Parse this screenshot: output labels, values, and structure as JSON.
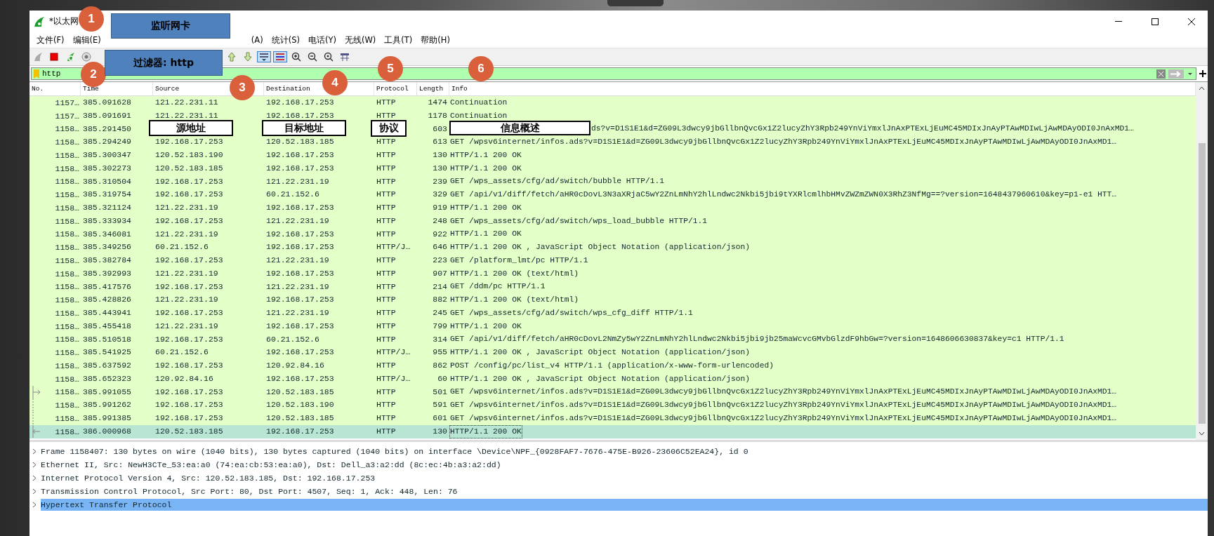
{
  "window": {
    "title": "*以太网"
  },
  "menu": [
    "文件(F)",
    "编辑(E)",
    "(A)",
    "统计(S)",
    "电话(Y)",
    "无线(W)",
    "工具(T)",
    "帮助(H)"
  ],
  "toolbar": [
    {
      "kind": "fin",
      "on": false
    },
    {
      "kind": "stop",
      "on": false
    },
    {
      "kind": "restart",
      "on": false
    },
    {
      "kind": "options",
      "on": false
    },
    {
      "kind": "first",
      "on": false
    },
    {
      "kind": "last",
      "on": false
    },
    {
      "kind": "autoscroll",
      "on": true
    },
    {
      "kind": "colorize",
      "on": true
    },
    {
      "kind": "zoom-in",
      "on": false
    },
    {
      "kind": "zoom-out",
      "on": false
    },
    {
      "kind": "zoom-reset",
      "on": false
    },
    {
      "kind": "resize",
      "on": false
    }
  ],
  "filter": {
    "value": "http"
  },
  "table": {
    "columns": [
      "No.",
      "Time",
      "Source",
      "Destination",
      "Protocol",
      "Length",
      "Info"
    ],
    "rows": [
      {
        "no": "1157…",
        "time": "385.091628",
        "source": "121.22.231.11",
        "destination": "192.168.17.253",
        "protocol": "HTTP",
        "length": "1474",
        "info": "Continuation",
        "selected": false
      },
      {
        "no": "1157…",
        "time": "385.091691",
        "source": "121.22.231.11",
        "destination": "192.168.17.253",
        "protocol": "HTTP",
        "length": "1178",
        "info": "Continuation",
        "selected": false
      },
      {
        "no": "1158…",
        "time": "385.291450",
        "length": "603",
        "info": "ds?v=D1S1E1&d=ZG09L3dwcy9jbGllbnQvcGx1Z2lucyZhY3Rpb249YnViYmxlJnAxPTExLjEuMC45MDIxJnAyPTAwMDIwLjAwMDAyODI0JnAxMD1…",
        "covered": true,
        "selected": false
      },
      {
        "no": "1158…",
        "time": "385.294249",
        "source": "192.168.17.253",
        "destination": "120.52.183.185",
        "protocol": "HTTP",
        "length": "613",
        "info": "GET /wpsv6internet/infos.ads?v=D1S1E1&d=ZG09L3dwcy9jbGllbnQvcGx1Z2lucyZhY3Rpb249YnViYmxlJnAxPTExLjEuMC45MDIxJnAyPTAwMDIwLjAwMDAyODI0JnAxMD1…",
        "selected": false
      },
      {
        "no": "1158…",
        "time": "385.300347",
        "source": "120.52.183.190",
        "destination": "192.168.17.253",
        "protocol": "HTTP",
        "length": "130",
        "info": "HTTP/1.1 200 OK",
        "selected": false
      },
      {
        "no": "1158…",
        "time": "385.302273",
        "source": "120.52.183.185",
        "destination": "192.168.17.253",
        "protocol": "HTTP",
        "length": "130",
        "info": "HTTP/1.1 200 OK",
        "selected": false
      },
      {
        "no": "1158…",
        "time": "385.310504",
        "source": "192.168.17.253",
        "destination": "121.22.231.19",
        "protocol": "HTTP",
        "length": "239",
        "info": "GET /wps_assets/cfg/ad/switch/bubble HTTP/1.1",
        "selected": false
      },
      {
        "no": "1158…",
        "time": "385.319754",
        "source": "192.168.17.253",
        "destination": "60.21.152.6",
        "protocol": "HTTP",
        "length": "329",
        "info": "GET /api/v1/diff/fetch/aHR0cDovL3N3aXRjaC5wY2ZnLmNhY2hlLndwc2Nkbi5jbi9tYXRlcmlhbHMvZWZmZWN0X3RhZ3NfMg==?version=1648437960610&key=p1-e1 HTT…",
        "selected": false
      },
      {
        "no": "1158…",
        "time": "385.321124",
        "source": "121.22.231.19",
        "destination": "192.168.17.253",
        "protocol": "HTTP",
        "length": "919",
        "info": "HTTP/1.1 200 OK",
        "selected": false
      },
      {
        "no": "1158…",
        "time": "385.333934",
        "source": "192.168.17.253",
        "destination": "121.22.231.19",
        "protocol": "HTTP",
        "length": "248",
        "info": "GET /wps_assets/cfg/ad/switch/wps_load_bubble HTTP/1.1",
        "selected": false
      },
      {
        "no": "1158…",
        "time": "385.346081",
        "source": "121.22.231.19",
        "destination": "192.168.17.253",
        "protocol": "HTTP",
        "length": "922",
        "info": "HTTP/1.1 200 OK",
        "selected": false
      },
      {
        "no": "1158…",
        "time": "385.349256",
        "source": "60.21.152.6",
        "destination": "192.168.17.253",
        "protocol": "HTTP/J…",
        "length": "646",
        "info": "HTTP/1.1 200 OK , JavaScript Object Notation (application/json)",
        "selected": false
      },
      {
        "no": "1158…",
        "time": "385.382784",
        "source": "192.168.17.253",
        "destination": "121.22.231.19",
        "protocol": "HTTP",
        "length": "223",
        "info": "GET /platform_lmt/pc HTTP/1.1",
        "selected": false
      },
      {
        "no": "1158…",
        "time": "385.392993",
        "source": "121.22.231.19",
        "destination": "192.168.17.253",
        "protocol": "HTTP",
        "length": "907",
        "info": "HTTP/1.1 200 OK  (text/html)",
        "selected": false
      },
      {
        "no": "1158…",
        "time": "385.417576",
        "source": "192.168.17.253",
        "destination": "121.22.231.19",
        "protocol": "HTTP",
        "length": "214",
        "info": "GET /ddm/pc HTTP/1.1",
        "selected": false
      },
      {
        "no": "1158…",
        "time": "385.428826",
        "source": "121.22.231.19",
        "destination": "192.168.17.253",
        "protocol": "HTTP",
        "length": "882",
        "info": "HTTP/1.1 200 OK  (text/html)",
        "selected": false
      },
      {
        "no": "1158…",
        "time": "385.443941",
        "source": "192.168.17.253",
        "destination": "121.22.231.19",
        "protocol": "HTTP",
        "length": "245",
        "info": "GET /wps_assets/cfg/ad/switch/wps_cfg_diff HTTP/1.1",
        "selected": false
      },
      {
        "no": "1158…",
        "time": "385.455418",
        "source": "121.22.231.19",
        "destination": "192.168.17.253",
        "protocol": "HTTP",
        "length": "799",
        "info": "HTTP/1.1 200 OK",
        "selected": false
      },
      {
        "no": "1158…",
        "time": "385.510518",
        "source": "192.168.17.253",
        "destination": "60.21.152.6",
        "protocol": "HTTP",
        "length": "314",
        "info": "GET /api/v1/diff/fetch/aHR0cDovL2NmZy5wY2ZnLmNhY2hlLndwc2Nkbi5jbi9jb25maWcvcGMvbGlzdF9hbGw=?version=1648606630837&key=c1 HTTP/1.1",
        "selected": false
      },
      {
        "no": "1158…",
        "time": "385.541925",
        "source": "60.21.152.6",
        "destination": "192.168.17.253",
        "protocol": "HTTP/J…",
        "length": "955",
        "info": "HTTP/1.1 200 OK , JavaScript Object Notation (application/json)",
        "selected": false
      },
      {
        "no": "1158…",
        "time": "385.637592",
        "source": "192.168.17.253",
        "destination": "120.92.84.16",
        "protocol": "HTTP",
        "length": "862",
        "info": "POST /config/pc/list_v4 HTTP/1.1  (application/x-www-form-urlencoded)",
        "selected": false
      },
      {
        "no": "1158…",
        "time": "385.652323",
        "source": "120.92.84.16",
        "destination": "192.168.17.253",
        "protocol": "HTTP/J…",
        "length": "60",
        "info": "HTTP/1.1 200 OK , JavaScript Object Notation (application/json)",
        "selected": false
      },
      {
        "no": "1158…",
        "time": "385.991055",
        "source": "192.168.17.253",
        "destination": "120.52.183.185",
        "protocol": "HTTP",
        "length": "501",
        "info": "GET /wpsv6internet/infos.ads?v=D1S1E1&d=ZG09L3dwcy9jbGllbnQvcGx1Z2lucyZhY3Rpb249YnViYmxlJnAxPTExLjEuMC45MDIxJnAyPTAwMDIwLjAwMDAyODI0JnAxMD1…",
        "request_arrow": true,
        "selected": false
      },
      {
        "no": "1158…",
        "time": "385.991262",
        "source": "192.168.17.253",
        "destination": "120.52.183.190",
        "protocol": "HTTP",
        "length": "591",
        "info": "GET /wpsv6internet/infos.ads?v=D1S1E1&d=ZG09L3dwcy9jbGllbnQvcGx1Z2lucyZhY3Rpb249YnViYmxlJnAxPTExLjEuMC45MDIxJnAyPTAwMDIwLjAwMDAyODI0JnAxMD1…",
        "related_line": true,
        "selected": false
      },
      {
        "no": "1158…",
        "time": "385.991385",
        "source": "192.168.17.253",
        "destination": "120.52.183.185",
        "protocol": "HTTP",
        "length": "601",
        "info": "GET /wpsv6internet/infos.ads?v=D1S1E1&d=ZG09L3dwcy9jbGllbnQvcGx1Z2lucyZhY3Rpb249YnViYmxlJnAxPTExLjEuMC45MDIxJnAyPTAwMDIwLjAwMDAyODI0JnAxMD1…",
        "related_line": true,
        "selected": false
      },
      {
        "no": "1158…",
        "time": "386.000968",
        "source": "120.52.183.185",
        "destination": "192.168.17.253",
        "protocol": "HTTP",
        "length": "130",
        "info": "HTTP/1.1 200 OK",
        "response_arrow": true,
        "selected": true
      }
    ]
  },
  "details": [
    {
      "text": "Frame 1158407: 130 bytes on wire (1040 bits), 130 bytes captured (1040 bits) on interface \\Device\\NPF_{0928FAF7-7676-475E-B926-23606C52EA24}, id 0",
      "expanded": false,
      "selected": false
    },
    {
      "text": "Ethernet II, Src: NewH3CTe_53:ea:a0 (74:ea:cb:53:ea:a0), Dst: Dell_a3:a2:dd (8c:ec:4b:a3:a2:dd)",
      "expanded": false,
      "selected": false
    },
    {
      "text": "Internet Protocol Version 4, Src: 120.52.183.185, Dst: 192.168.17.253",
      "expanded": false,
      "selected": false
    },
    {
      "text": "Transmission Control Protocol, Src Port: 80, Dst Port: 4507, Seq: 1, Ack: 448, Len: 76",
      "expanded": false,
      "selected": false
    },
    {
      "text": "Hypertext Transfer Protocol",
      "expanded": false,
      "selected": true
    }
  ],
  "annotations": [
    {
      "kind": "circle",
      "text": "1"
    },
    {
      "kind": "callout",
      "text": "监听网卡"
    },
    {
      "kind": "circle",
      "text": "2"
    },
    {
      "kind": "callout",
      "text": "过滤器: http"
    },
    {
      "kind": "circle",
      "text": "3"
    },
    {
      "kind": "circle",
      "text": "4"
    },
    {
      "kind": "circle",
      "text": "5"
    },
    {
      "kind": "circle",
      "text": "6"
    },
    {
      "kind": "label",
      "text": "源地址"
    },
    {
      "kind": "label",
      "text": "目标地址"
    },
    {
      "kind": "label",
      "text": "协议"
    },
    {
      "kind": "label",
      "text": "信息概述"
    }
  ]
}
